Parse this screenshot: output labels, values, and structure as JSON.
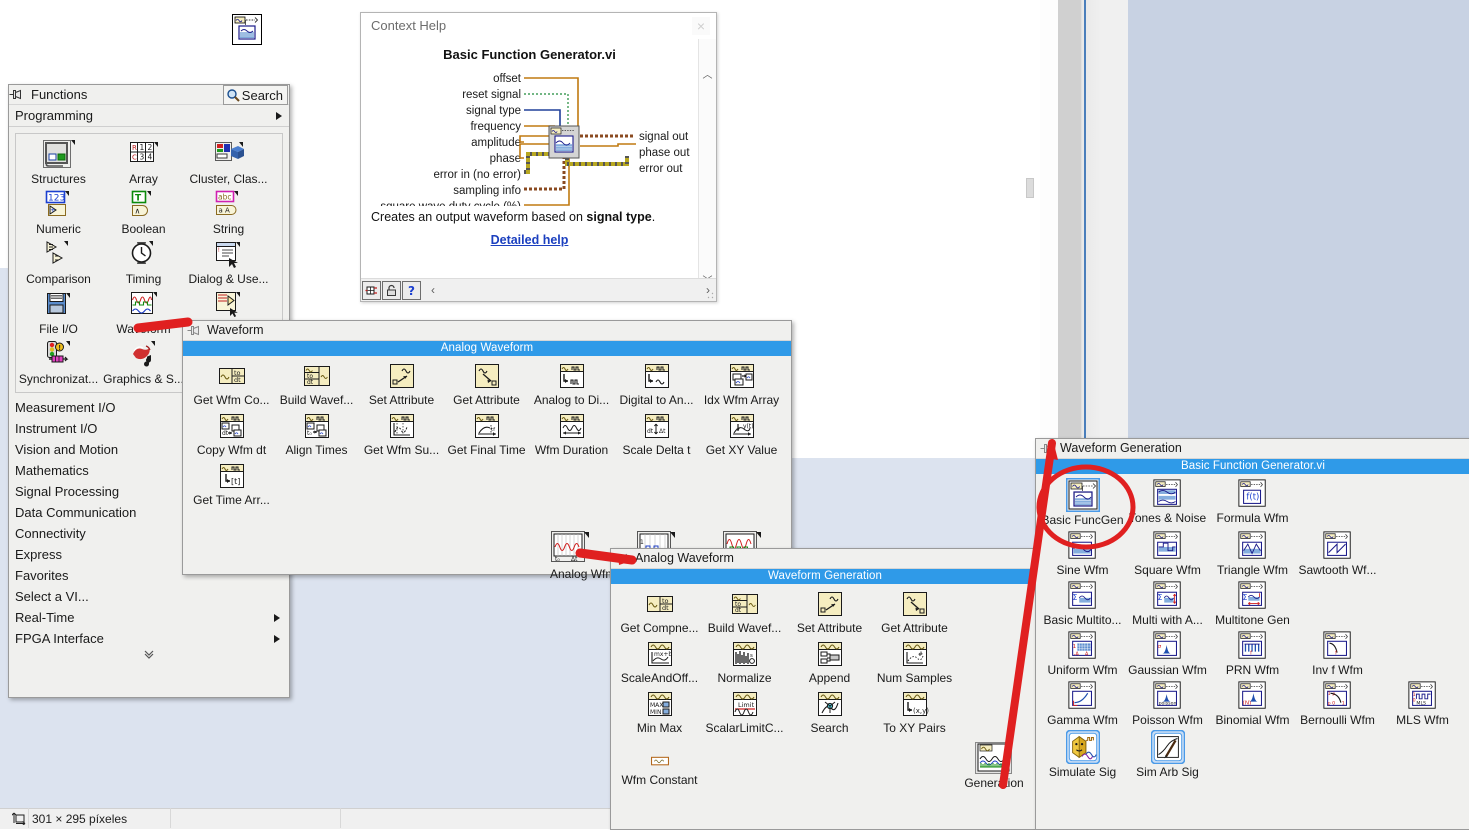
{
  "status_bar": {
    "dimension_text": "301 × 295 píxeles",
    "icon": "selection-size-icon"
  },
  "functions_palette": {
    "title": "Functions",
    "pin_icon": "pin-icon",
    "search_label": "Search",
    "search_icon": "magnifier-icon",
    "subtitle": "Programming",
    "icons": [
      {
        "label": "Structures",
        "icon": "structures-icon"
      },
      {
        "label": "Array",
        "icon": "array-icon"
      },
      {
        "label": "Cluster, Clas...",
        "icon": "cluster-class-icon"
      },
      {
        "label": "Numeric",
        "icon": "numeric-icon"
      },
      {
        "label": "Boolean",
        "icon": "boolean-icon"
      },
      {
        "label": "String",
        "icon": "string-icon"
      },
      {
        "label": "Comparison",
        "icon": "comparison-icon"
      },
      {
        "label": "Timing",
        "icon": "timing-icon"
      },
      {
        "label": "Dialog & Use...",
        "icon": "dialog-user-icon"
      },
      {
        "label": "File I/O",
        "icon": "file-io-icon"
      },
      {
        "label": "Waveform",
        "icon": "waveform-icon"
      },
      {
        "label": "",
        "icon": "app-control-icon"
      },
      {
        "label": "Synchronizat...",
        "icon": "synchronization-icon"
      },
      {
        "label": "Graphics & S...",
        "icon": "graphics-sound-icon"
      },
      {
        "label": "",
        "icon": "blank-icon"
      }
    ],
    "categories": [
      {
        "label": "Measurement I/O",
        "has_arrow": false
      },
      {
        "label": "Instrument I/O",
        "has_arrow": false
      },
      {
        "label": "Vision and Motion",
        "has_arrow": false
      },
      {
        "label": "Mathematics",
        "has_arrow": false
      },
      {
        "label": "Signal Processing",
        "has_arrow": false
      },
      {
        "label": "Data Communication",
        "has_arrow": false
      },
      {
        "label": "Connectivity",
        "has_arrow": false
      },
      {
        "label": "Express",
        "has_arrow": false
      },
      {
        "label": "Favorites",
        "has_arrow": false
      },
      {
        "label": "Select a VI...",
        "has_arrow": false
      },
      {
        "label": "Real-Time",
        "has_arrow": true
      },
      {
        "label": "FPGA Interface",
        "has_arrow": true
      }
    ],
    "expand_chevron": "chevron-double-down-icon"
  },
  "context_help": {
    "window_title": "Context Help",
    "close_icon": "close-icon",
    "vi_title": "Basic Function Generator.vi",
    "inputs": [
      "offset",
      "reset signal",
      "signal type",
      "frequency",
      "amplitude",
      "phase",
      "error in (no error)",
      "sampling info",
      "square wave duty cycle (%)"
    ],
    "outputs": [
      "signal out",
      "phase out",
      "error out"
    ],
    "description_prefix": "Creates an output waveform based on ",
    "description_bold": "signal type",
    "description_suffix": ".",
    "detailed_help_label": "Detailed help",
    "toolbar_icons": [
      "show-optional-terminals-icon",
      "lock-help-icon",
      "detailed-help-icon"
    ],
    "hscroll_left_icon": "chevron-left-icon",
    "hscroll_right_icon": "chevron-right-icon",
    "vscroll_up_icon": "chevron-up-icon",
    "vscroll_down_icon": "chevron-down-icon"
  },
  "analog_waveform_palette": {
    "title": "Waveform",
    "pin_icon": "pin-icon",
    "bluebar_label": "Analog Waveform",
    "items": [
      {
        "label": "Get Wfm Co...",
        "icon": "get-wfm-components-icon"
      },
      {
        "label": "Build Wavef...",
        "icon": "build-waveform-icon"
      },
      {
        "label": "Set Attribute",
        "icon": "set-attribute-icon"
      },
      {
        "label": "Get Attribute",
        "icon": "get-attribute-icon"
      },
      {
        "label": "Analog to Di...",
        "icon": "analog-to-digital-icon"
      },
      {
        "label": "Digital to An...",
        "icon": "digital-to-analog-icon"
      },
      {
        "label": "Idx Wfm Array",
        "icon": "index-wfm-array-icon"
      },
      {
        "label": "Copy Wfm dt",
        "icon": "copy-wfm-dt-icon"
      },
      {
        "label": "Align Times",
        "icon": "align-times-icon"
      },
      {
        "label": "Get Wfm Su...",
        "icon": "get-wfm-subset-icon"
      },
      {
        "label": "Get Final Time",
        "icon": "get-final-time-icon"
      },
      {
        "label": "Wfm Duration",
        "icon": "wfm-duration-icon"
      },
      {
        "label": "Scale Delta t",
        "icon": "scale-delta-t-icon"
      },
      {
        "label": "Get XY Value",
        "icon": "get-xy-value-icon"
      },
      {
        "label": "Get Time Arr...",
        "icon": "get-time-array-icon"
      }
    ],
    "subpalette_items": [
      {
        "label": "Analog Wfm",
        "icon": "analog-wfm-subpalette-icon"
      },
      {
        "label": "",
        "icon": "digital-wfm-subpalette-icon"
      },
      {
        "label": "",
        "icon": "wfm-generation-subpalette-icon"
      }
    ]
  },
  "waveform_generation_palette": {
    "title": "Analog Waveform",
    "pin_icon": "pin-icon",
    "bluebar_label": "Waveform Generation",
    "items": [
      {
        "label": "Get Compne...",
        "icon": "get-components-icon"
      },
      {
        "label": "Build Wavef...",
        "icon": "build-waveform-icon"
      },
      {
        "label": "Set Attribute",
        "icon": "set-attribute-icon"
      },
      {
        "label": "Get Attribute",
        "icon": "get-attribute-icon"
      },
      {
        "label": "ScaleAndOff...",
        "icon": "scale-and-offset-icon"
      },
      {
        "label": "Normalize",
        "icon": "normalize-icon"
      },
      {
        "label": "Append",
        "icon": "append-icon"
      },
      {
        "label": "Num Samples",
        "icon": "num-samples-icon"
      },
      {
        "label": "Min Max",
        "icon": "min-max-icon"
      },
      {
        "label": "ScalarLimitC...",
        "icon": "scalar-limit-compare-icon"
      },
      {
        "label": "Search",
        "icon": "search-wfm-icon"
      },
      {
        "label": "To XY Pairs",
        "icon": "to-xy-pairs-icon"
      },
      {
        "label": "Wfm Constant",
        "icon": "wfm-constant-icon"
      }
    ],
    "generation_item": {
      "label": "Generation",
      "icon": "generation-subpalette-icon"
    }
  },
  "waveform_generation_right": {
    "title": "Waveform Generation",
    "pin_icon": "pin-icon",
    "bluebar_label": "Basic Function Generator.vi",
    "items": [
      {
        "label": "Basic FuncGen",
        "icon": "basic-function-generator-icon",
        "selected": true
      },
      {
        "label": "Tones & Noise",
        "icon": "tones-and-noise-icon"
      },
      {
        "label": "Formula Wfm",
        "icon": "formula-waveform-icon"
      },
      {
        "label": "Sine Wfm",
        "icon": "sine-waveform-icon"
      },
      {
        "label": "Square Wfm",
        "icon": "square-waveform-icon"
      },
      {
        "label": "Triangle Wfm",
        "icon": "triangle-waveform-icon"
      },
      {
        "label": "Sawtooth Wf...",
        "icon": "sawtooth-waveform-icon"
      },
      {
        "label": "Basic Multito...",
        "icon": "basic-multitone-icon"
      },
      {
        "label": "Multi with A...",
        "icon": "multitone-with-amplitude-icon"
      },
      {
        "label": "Multitone Gen",
        "icon": "multitone-generator-icon"
      },
      {
        "label": "Uniform Wfm",
        "icon": "uniform-white-noise-icon"
      },
      {
        "label": "Gaussian Wfm",
        "icon": "gaussian-white-noise-icon"
      },
      {
        "label": "PRN Wfm",
        "icon": "periodic-random-noise-icon"
      },
      {
        "label": "Inv f Wfm",
        "icon": "inverse-f-noise-icon"
      },
      {
        "label": "Gamma Wfm",
        "icon": "gamma-noise-icon"
      },
      {
        "label": "Poisson Wfm",
        "icon": "poisson-noise-icon"
      },
      {
        "label": "Binomial Wfm",
        "icon": "binomial-noise-icon"
      },
      {
        "label": "Bernoulli Wfm",
        "icon": "bernoulli-noise-icon"
      },
      {
        "label": "MLS Wfm",
        "icon": "mls-sequence-icon"
      },
      {
        "label": "Simulate Sig",
        "icon": "simulate-signal-express-icon"
      },
      {
        "label": "Sim Arb Sig",
        "icon": "simulate-arbitrary-signal-icon"
      }
    ]
  },
  "dragged_item": {
    "icon": "basic-function-generator-icon",
    "label": ""
  },
  "annotations": {
    "marker_color": "#e02020",
    "items": [
      {
        "name": "arrow-waveform-to-palette",
        "type": "arrow"
      },
      {
        "name": "arrow-analogwfm-to-palette",
        "type": "arrow"
      },
      {
        "name": "arrow-generation-to-palette",
        "type": "arrow"
      },
      {
        "name": "circle-basic-funcgen",
        "type": "ellipse"
      }
    ]
  },
  "colors": {
    "palette_bg": "#f0f0ee",
    "bluebar": "#2f9ae8",
    "desktop_blue": "#dce3ef",
    "marker_red": "#e02020",
    "link_blue": "#1b3fbf",
    "icon_yellow": "#f5edc0",
    "icon_gray": "#c8c8c8"
  }
}
